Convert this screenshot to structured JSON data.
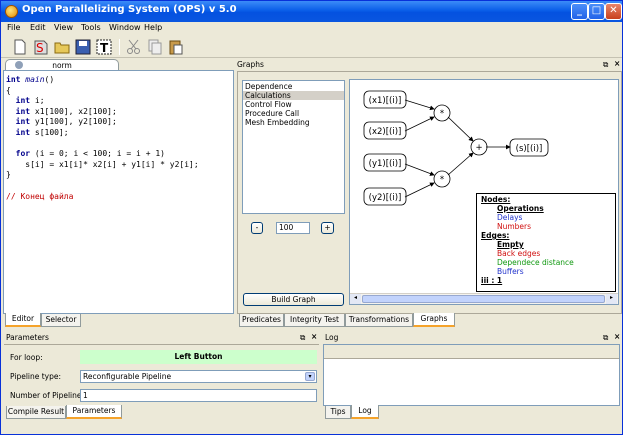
{
  "window": {
    "title": "Open Parallelizing System (OPS) v 5.0",
    "min": "_",
    "max": "□",
    "close": "✕"
  },
  "menu": [
    "File",
    "Edit",
    "View",
    "Tools",
    "Window",
    "Help"
  ],
  "editor": {
    "file_tab": "norm",
    "code": {
      "l1_kw": "int",
      "l1_fn": "main",
      "l1_rest": "()",
      "l2": "{",
      "l3_kw": "int",
      "l3_rest": " i;",
      "l4_kw": "int",
      "l4_rest": " x1[100], x2[100];",
      "l5_kw": "int",
      "l5_rest": " y1[100], y2[100];",
      "l6_kw": "int",
      "l6_rest": " s[100];",
      "l7_kw": "for",
      "l7_rest": " (i = 0; i < 100; i = i + 1)",
      "l8": "s[i] = x1[i]* x2[i] + y1[i] * y2[i];",
      "l9": "}",
      "l10": "// Конец файла"
    },
    "tabs": [
      "Editor",
      "Selector"
    ]
  },
  "graphs": {
    "title": "Graphs",
    "list": [
      "Dependence",
      "Calculations",
      "Control Flow",
      "Procedure Call",
      "Mesh Embedding"
    ],
    "selected_index": 1,
    "zoom_minus": "-",
    "zoom_value": "100",
    "zoom_plus": "+",
    "build_button": "Build Graph",
    "nodes": {
      "x1": "(x1)[(i)]",
      "x2": "(x2)[(i)]",
      "y1": "(y1)[(i)]",
      "y2": "(y2)[(i)]",
      "mul": "*",
      "add": "+",
      "s": "(s)[(i)]"
    },
    "legend": {
      "nodes_h": "Nodes:",
      "operations": "Operations",
      "delays": "Delays",
      "numbers": "Numbers",
      "edges_h": "Edges:",
      "empty": "Empty",
      "back": "Back edges",
      "dependece": "Dependece distance",
      "buffers": "Buffers",
      "iii": "iii :   1"
    },
    "tabs": [
      "Predicates",
      "Integrity Test",
      "Transformations",
      "Graphs"
    ]
  },
  "parameters": {
    "title": "Parameters",
    "for_loop_label": "For loop:",
    "for_loop_value": "Left Button",
    "pipeline_type_label": "Pipeline type:",
    "pipeline_type_value": "Reconfigurable Pipeline",
    "num_pipelines_label": "Number of Pipelines:",
    "num_pipelines_value": "1",
    "tabs": [
      "Compile Result",
      "Parameters"
    ]
  },
  "log": {
    "title": "Log",
    "tabs": [
      "Tips",
      "Log"
    ]
  },
  "colors": {
    "accent_tab": "#f5a32b",
    "titlebar": "#0a5ee8",
    "green_field": "#ccffcc",
    "delay": "#2233cc",
    "number": "#d01010",
    "back_edge": "#d01010",
    "dep": "#119911",
    "buffer": "#2233cc"
  }
}
